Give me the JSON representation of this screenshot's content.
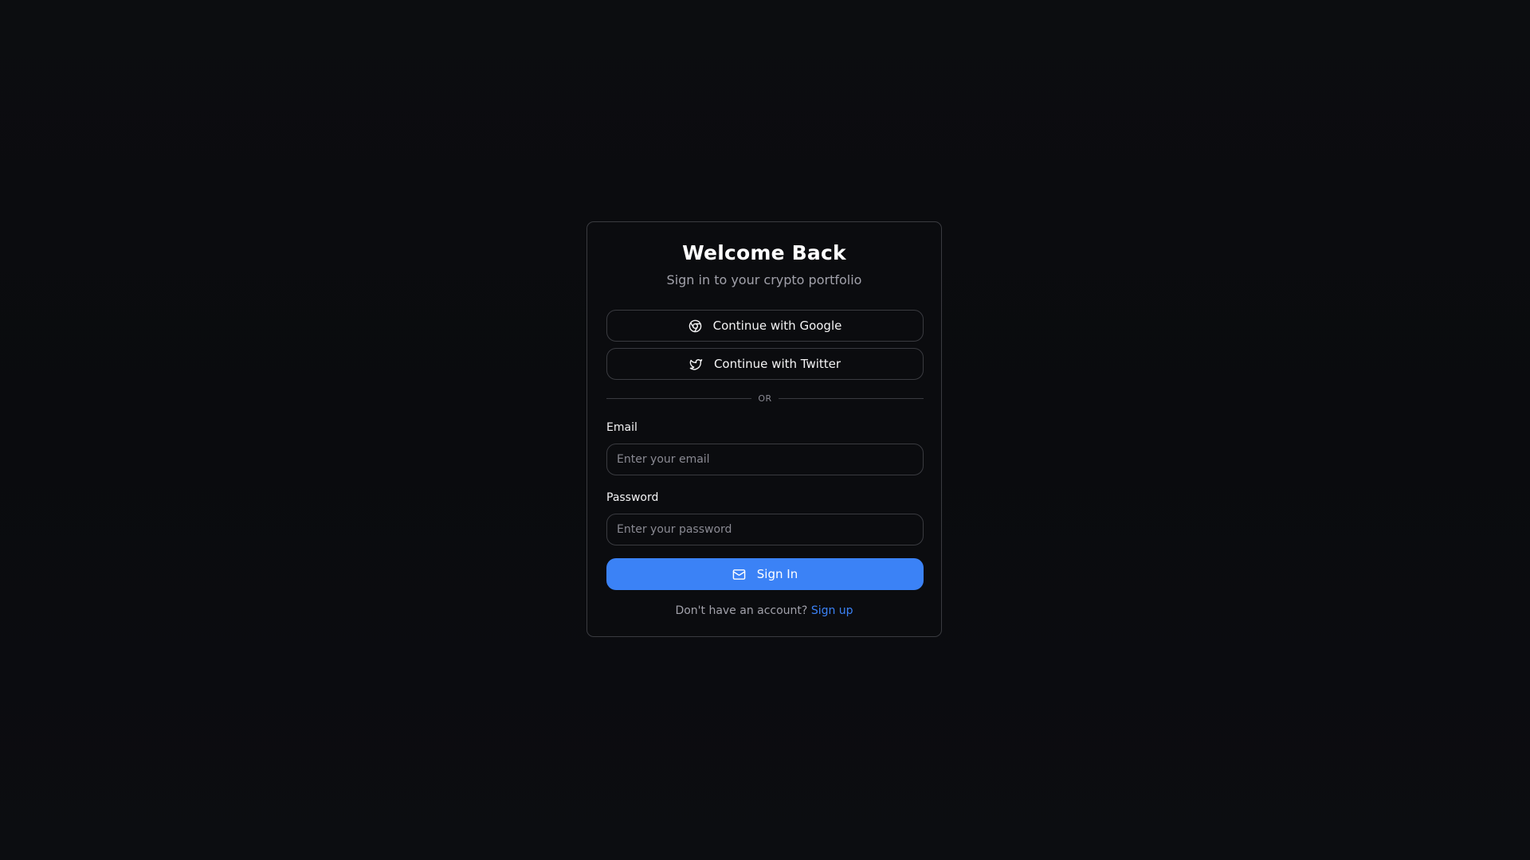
{
  "login": {
    "title": "Welcome Back",
    "subtitle": "Sign in to your crypto portfolio",
    "google_button_label": "Continue with Google",
    "twitter_button_label": "Continue with Twitter",
    "divider_text": "OR",
    "email_label": "Email",
    "email_placeholder": "Enter your email",
    "email_value": "",
    "password_label": "Password",
    "password_placeholder": "Enter your password",
    "password_value": "",
    "signin_button_label": "Sign In",
    "footer_text": "Don't have an account?",
    "signup_link_label": "Sign up"
  },
  "icons": {
    "google": "chrome-icon",
    "twitter": "twitter-icon",
    "signin": "mail-icon"
  },
  "colors": {
    "background": "#0b0c0f",
    "accent": "#3b82f6",
    "border": "#3a3b40",
    "muted_text": "#a1a1aa"
  }
}
